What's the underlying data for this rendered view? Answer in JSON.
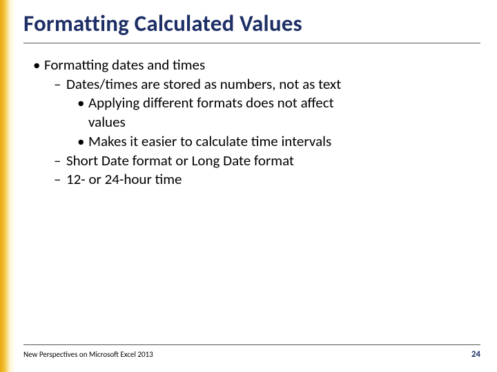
{
  "title": "Formatting Calculated Values",
  "bullets": {
    "l1_1": "Formatting dates and times",
    "l2_1": "Dates/times are stored as numbers, not as text",
    "l3_1a": "Applying different formats does not affect",
    "l3_1b": "values",
    "l3_2": "Makes it easier to calculate time intervals",
    "l2_2": "Short Date format or Long Date format",
    "l2_3": "12- or 24-hour time"
  },
  "footer": {
    "text": "New Perspectives on Microsoft Excel 2013",
    "page": "24"
  }
}
